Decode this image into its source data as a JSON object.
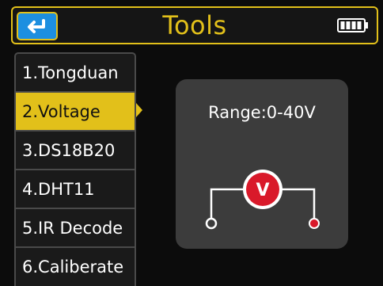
{
  "header": {
    "title": "Tools",
    "back_icon": "return-arrow-icon",
    "battery_icon": "battery-full-icon",
    "accent_color": "#e2c01a",
    "back_button_color": "#1d8fe0"
  },
  "menu": {
    "selected_index": 1,
    "items": [
      {
        "label": "1.Tongduan"
      },
      {
        "label": "2.Voltage"
      },
      {
        "label": "3.DS18B20"
      },
      {
        "label": "4.DHT11"
      },
      {
        "label": "5.IR Decode"
      },
      {
        "label": "6.Caliberate"
      }
    ]
  },
  "detail": {
    "range_text": "Range:0-40V",
    "meter_symbol": "V",
    "meter_icon": "voltmeter-icon",
    "meter_color": "#d9192a"
  }
}
